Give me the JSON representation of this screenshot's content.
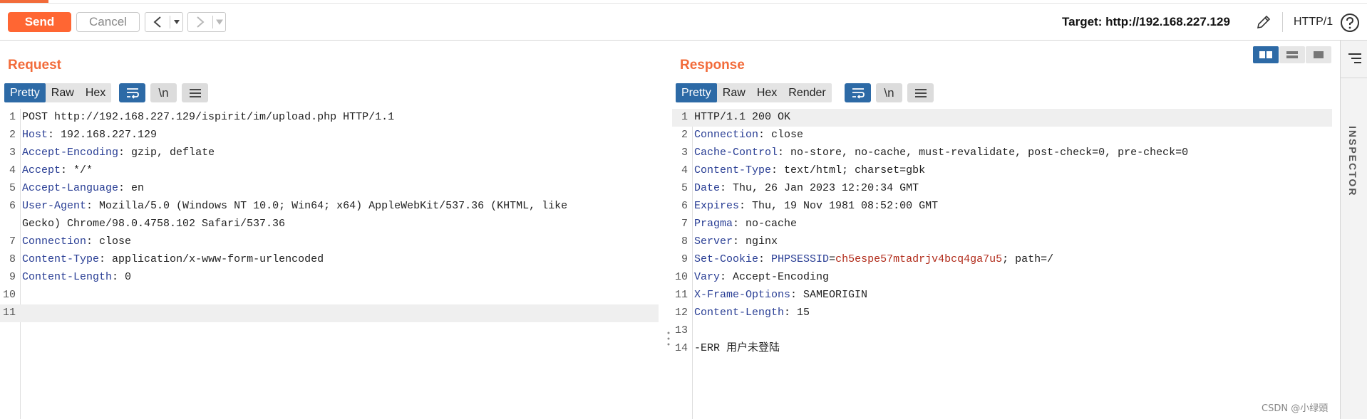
{
  "toolbar": {
    "send_label": "Send",
    "cancel_label": "Cancel",
    "target_label": "Target: http://192.168.227.129",
    "http_version": "HTTP/1"
  },
  "request": {
    "title": "Request",
    "tabs": [
      "Pretty",
      "Raw",
      "Hex"
    ],
    "active_tab": "Pretty",
    "newline_label": "\\n",
    "lines": [
      {
        "n": "1",
        "key": "",
        "val": "POST http://192.168.227.129/ispirit/im/upload.php HTTP/1.1"
      },
      {
        "n": "2",
        "key": "Host",
        "val": " 192.168.227.129"
      },
      {
        "n": "3",
        "key": "Accept-Encoding",
        "val": " gzip, deflate"
      },
      {
        "n": "4",
        "key": "Accept",
        "val": " */*"
      },
      {
        "n": "5",
        "key": "Accept-Language",
        "val": " en"
      },
      {
        "n": "6",
        "key": "User-Agent",
        "val": " Mozilla/5.0 (Windows NT 10.0; Win64; x64) AppleWebKit/537.36 (KHTML, like"
      },
      {
        "n": "",
        "key": "",
        "val": "Gecko) Chrome/98.0.4758.102 Safari/537.36"
      },
      {
        "n": "7",
        "key": "Connection",
        "val": " close"
      },
      {
        "n": "8",
        "key": "Content-Type",
        "val": " application/x-www-form-urlencoded"
      },
      {
        "n": "9",
        "key": "Content-Length",
        "val": " 0"
      },
      {
        "n": "10",
        "key": "",
        "val": ""
      },
      {
        "n": "11",
        "key": "",
        "val": ""
      }
    ]
  },
  "response": {
    "title": "Response",
    "tabs": [
      "Pretty",
      "Raw",
      "Hex",
      "Render"
    ],
    "active_tab": "Pretty",
    "newline_label": "\\n",
    "lines": [
      {
        "n": "1",
        "key": "",
        "val": "HTTP/1.1 200 OK"
      },
      {
        "n": "2",
        "key": "Connection",
        "val": " close"
      },
      {
        "n": "3",
        "key": "Cache-Control",
        "val": " no-store, no-cache, must-revalidate, post-check=0, pre-check=0"
      },
      {
        "n": "4",
        "key": "Content-Type",
        "val": " text/html; charset=gbk"
      },
      {
        "n": "5",
        "key": "Date",
        "val": " Thu, 26 Jan 2023 12:20:34 GMT"
      },
      {
        "n": "6",
        "key": "Expires",
        "val": " Thu, 19 Nov 1981 08:52:00 GMT"
      },
      {
        "n": "7",
        "key": "Pragma",
        "val": " no-cache"
      },
      {
        "n": "8",
        "key": "Server",
        "val": " nginx"
      },
      {
        "n": "9",
        "key": "Set-Cookie",
        "val": " ",
        "cookie_name": "PHPSESSID",
        "cookie_value": "ch5espe57mtadrjv4bcq4ga7u5",
        "cookie_rest": "; path=/"
      },
      {
        "n": "10",
        "key": "Vary",
        "val": " Accept-Encoding"
      },
      {
        "n": "11",
        "key": "X-Frame-Options",
        "val": " SAMEORIGIN"
      },
      {
        "n": "12",
        "key": "Content-Length",
        "val": " 15"
      },
      {
        "n": "13",
        "key": "",
        "val": ""
      },
      {
        "n": "14",
        "key": "",
        "val": "-ERR 用户未登陆"
      }
    ]
  },
  "inspector": {
    "label": "INSPECTOR"
  },
  "watermark": "CSDN @小绿頭",
  "icons": {
    "edit": "pencil-icon",
    "help": "help-circle-icon",
    "wrap": "word-wrap-icon",
    "menu": "hamburger-menu-icon"
  },
  "colors": {
    "accent": "#f26b3a",
    "send": "#ff6633",
    "tab_active": "#2d6aa6",
    "header_key": "#283d94",
    "cookie_value": "#b12b1a"
  }
}
